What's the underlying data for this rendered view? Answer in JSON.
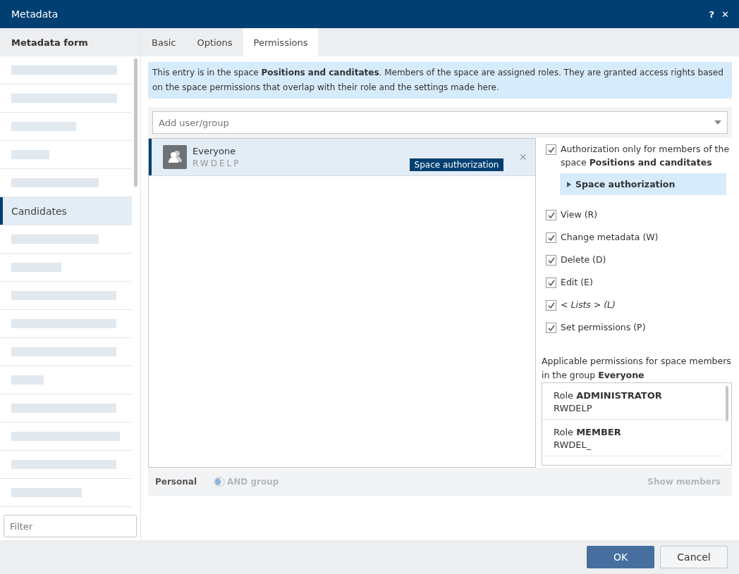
{
  "window": {
    "title": "Metadata",
    "help": "?",
    "close": "✕"
  },
  "sidebar": {
    "title": "Metadata form",
    "filter_placeholder": "Filter",
    "items": [
      {
        "kind": "redacted",
        "selected": false
      },
      {
        "kind": "redacted",
        "selected": false
      },
      {
        "kind": "redacted",
        "selected": false
      },
      {
        "kind": "redacted",
        "selected": false
      },
      {
        "kind": "redacted",
        "selected": false
      },
      {
        "kind": "text",
        "label": "Candidates",
        "selected": true
      },
      {
        "kind": "redacted",
        "selected": false
      },
      {
        "kind": "redacted",
        "selected": false
      },
      {
        "kind": "redacted",
        "selected": false
      },
      {
        "kind": "redacted",
        "selected": false
      },
      {
        "kind": "redacted",
        "selected": false
      },
      {
        "kind": "redacted",
        "selected": false
      },
      {
        "kind": "redacted",
        "selected": false
      },
      {
        "kind": "redacted",
        "selected": false
      },
      {
        "kind": "redacted",
        "selected": false
      },
      {
        "kind": "redacted",
        "selected": false
      }
    ]
  },
  "tabs": [
    {
      "label": "Basic",
      "selected": false
    },
    {
      "label": "Options",
      "selected": false
    },
    {
      "label": "Permissions",
      "selected": true
    }
  ],
  "info": "This entry is in the space **Positions and canditates**. Members of the space are assigned roles. They are granted access rights based on the space permissions that overlap with their role and the settings made here.",
  "add_field": {
    "placeholder": "Add user/group"
  },
  "entries": [
    {
      "name": "Everyone",
      "rights": "RWDELP",
      "tag": "Space authorization",
      "remove": "×",
      "selected": true
    }
  ],
  "restriction": {
    "label": "Authorization only for members of the space **Positions and canditates**",
    "checked": true
  },
  "expander": {
    "label": "Space authorization",
    "expanded": false
  },
  "permissions": [
    {
      "label": "View (R)",
      "checked": true,
      "kind": "plain"
    },
    {
      "label": "Change metadata (W)",
      "checked": true,
      "kind": "plain"
    },
    {
      "label": "Delete (D)",
      "checked": true,
      "kind": "plain"
    },
    {
      "label": "Edit (E)",
      "checked": true,
      "kind": "plain"
    },
    {
      "label": "< Lists > (L)",
      "checked": true,
      "kind": "italic"
    },
    {
      "label": "Set permissions (P)",
      "checked": true,
      "kind": "plain"
    }
  ],
  "applicable": {
    "label": "Applicable permissions for space members in the group **Everyone**",
    "roles": [
      {
        "role": "Role **ADMINISTRATOR**",
        "rights": "RWDELP"
      },
      {
        "role": "Role **MEMBER**",
        "rights": "RWDEL_"
      }
    ]
  },
  "bottom_bar": {
    "personal": "Personal",
    "and_group": {
      "label": "AND group",
      "on": false,
      "disabled": true
    },
    "show_members": {
      "label": "Show members",
      "disabled": true
    }
  },
  "buttons": [
    {
      "label": "OK",
      "kind": "primary"
    },
    {
      "label": "Cancel",
      "kind": "secondary"
    }
  ]
}
